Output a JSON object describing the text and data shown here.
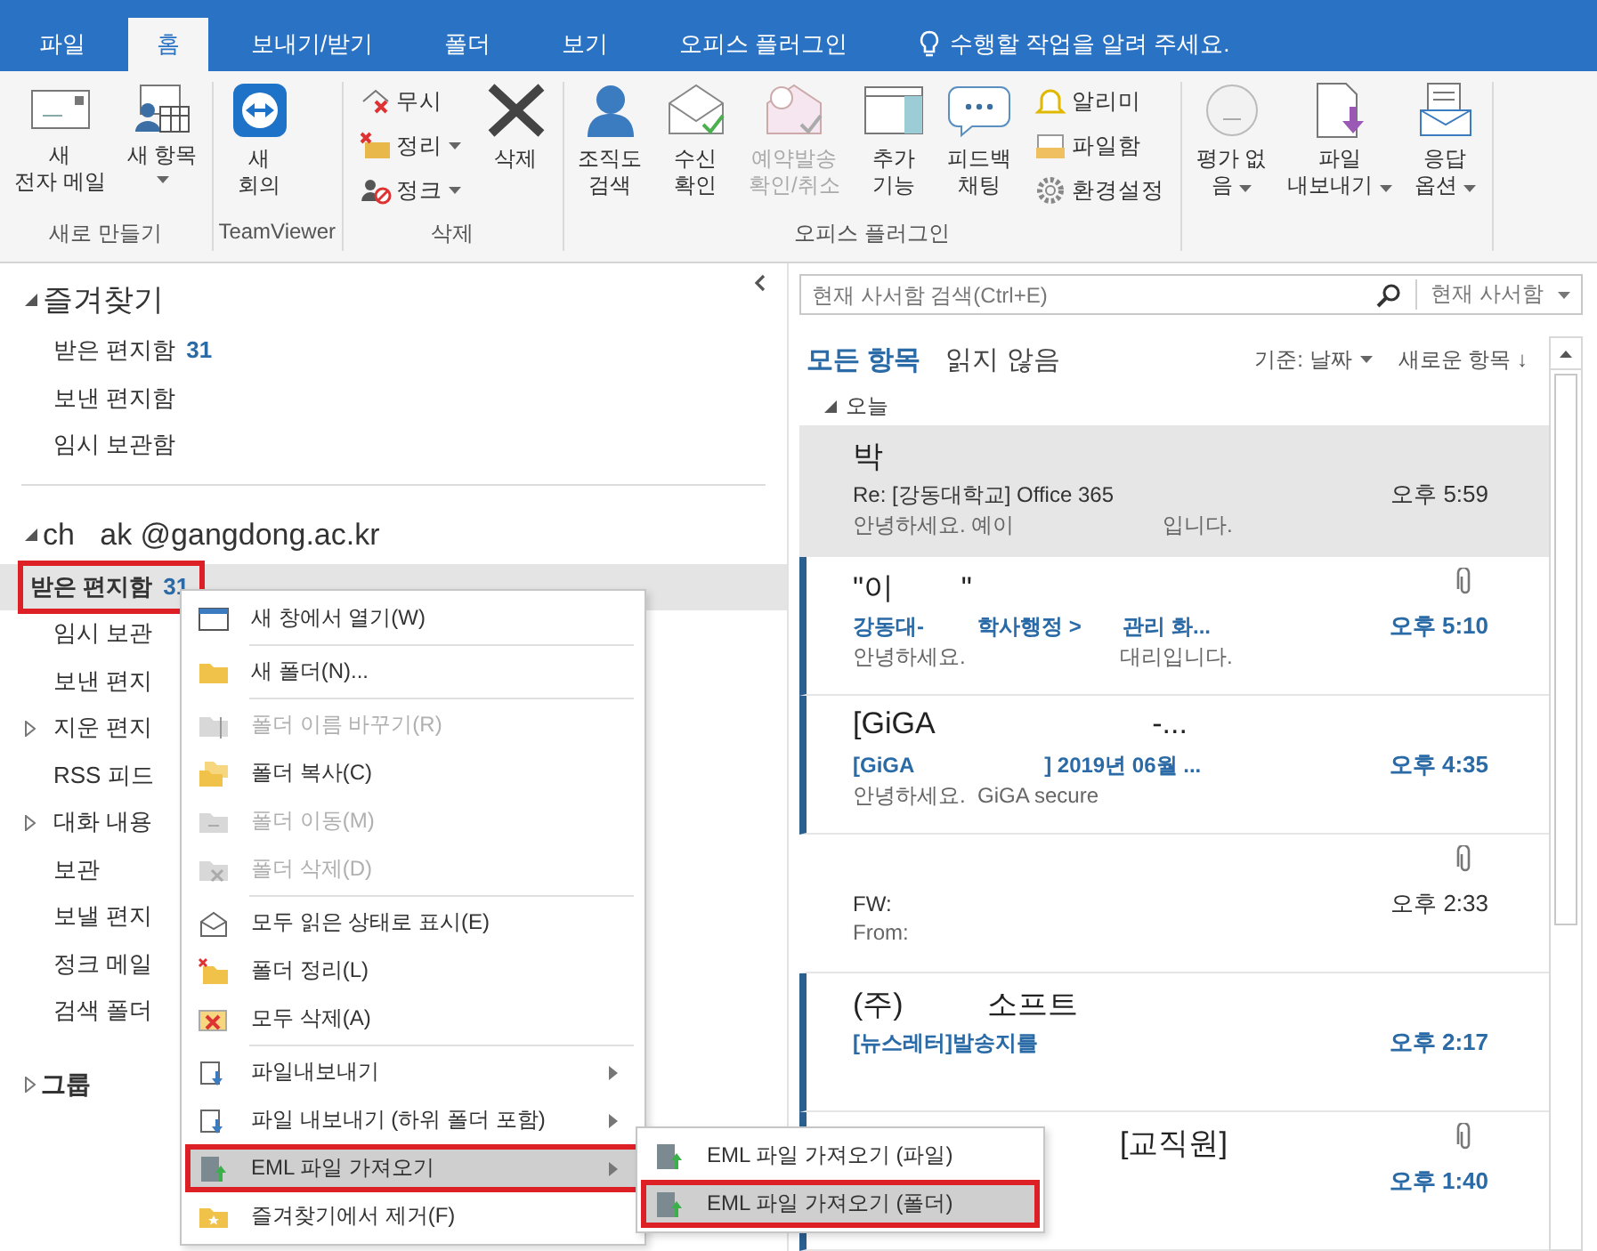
{
  "tabs": [
    {
      "label": "파일",
      "selected": false
    },
    {
      "label": "홈",
      "selected": true
    },
    {
      "label": "보내기/받기",
      "selected": false
    },
    {
      "label": "폴더",
      "selected": false
    },
    {
      "label": "보기",
      "selected": false
    },
    {
      "label": "오피스 플러그인",
      "selected": false
    }
  ],
  "tell_me": "수행할 작업을 알려 주세요.",
  "ribbon": {
    "groups": [
      {
        "label": "새로 만들기",
        "buttons": [
          {
            "kind": "large",
            "label": "새\n전자 메일",
            "dropdown": false,
            "disabled": false
          },
          {
            "kind": "large",
            "label": "새 항목",
            "dropdown": true,
            "disabled": false
          }
        ]
      },
      {
        "label": "TeamViewer",
        "buttons": [
          {
            "kind": "large",
            "label": "새\n회의",
            "dropdown": false,
            "disabled": false
          }
        ]
      },
      {
        "label": "삭제",
        "buttons": [
          {
            "kind": "stack",
            "items": [
              {
                "label": "무시",
                "dropdown": false
              },
              {
                "label": "정리",
                "dropdown": true
              },
              {
                "label": "정크",
                "dropdown": true
              }
            ]
          },
          {
            "kind": "large",
            "label": "삭제",
            "dropdown": false,
            "disabled": false
          }
        ]
      },
      {
        "label": "오피스 플러그인",
        "buttons": [
          {
            "kind": "large",
            "label": "조직도\n검색",
            "dropdown": false,
            "disabled": false
          },
          {
            "kind": "large",
            "label": "수신\n확인",
            "dropdown": false,
            "disabled": false
          },
          {
            "kind": "large",
            "label": "예약발송\n확인/취소",
            "dropdown": false,
            "disabled": true
          },
          {
            "kind": "large",
            "label": "추가\n기능",
            "dropdown": false,
            "disabled": false
          },
          {
            "kind": "large",
            "label": "피드백\n채팅",
            "dropdown": false,
            "disabled": false
          },
          {
            "kind": "stack",
            "items": [
              {
                "label": "알리미",
                "dropdown": false
              },
              {
                "label": "파일함",
                "dropdown": false
              },
              {
                "label": "환경설정",
                "dropdown": false
              }
            ]
          }
        ]
      },
      {
        "buttons": [
          {
            "kind": "large",
            "label": "평가 없\n음",
            "dropdown": true,
            "disabled": false
          },
          {
            "kind": "large",
            "label": "파일\n내보내기",
            "dropdown": true,
            "disabled": false
          },
          {
            "kind": "large",
            "label": "응답\n옵션",
            "dropdown": true,
            "disabled": false
          }
        ]
      }
    ]
  },
  "folder_pane": {
    "sections": [
      {
        "title": "즐겨찾기",
        "expanded": true,
        "folders": [
          {
            "name": "받은 편지함",
            "count": "31",
            "collapsed": false,
            "selected": false,
            "outlined": false
          },
          {
            "name": "보낸 편지함",
            "collapsed": false,
            "selected": false,
            "outlined": false
          },
          {
            "name": "임시 보관함",
            "collapsed": false,
            "selected": false,
            "outlined": false
          }
        ]
      },
      {
        "title": "ch   ak @gangdong.ac.kr",
        "expanded": true,
        "folders": [
          {
            "name": "받은 편지함",
            "count": "31",
            "collapsed": false,
            "selected": true,
            "outlined": true
          },
          {
            "name": "임시 보관",
            "collapsed": false,
            "selected": false,
            "outlined": false
          },
          {
            "name": "보낸 편지",
            "collapsed": false,
            "selected": false,
            "outlined": false
          },
          {
            "name": "지운 편지",
            "collapsed": true,
            "selected": false,
            "outlined": false
          },
          {
            "name": "RSS 피드",
            "collapsed": false,
            "selected": false,
            "outlined": false
          },
          {
            "name": "대화 내용",
            "collapsed": true,
            "selected": false,
            "outlined": false
          },
          {
            "name": "보관",
            "collapsed": false,
            "selected": false,
            "outlined": false
          },
          {
            "name": "보낼 편지",
            "collapsed": false,
            "selected": false,
            "outlined": false
          },
          {
            "name": "정크 메일",
            "collapsed": false,
            "selected": false,
            "outlined": false
          },
          {
            "name": "검색 폴더",
            "collapsed": false,
            "selected": false,
            "outlined": false
          }
        ]
      },
      {
        "title": "그룹",
        "expanded": false
      }
    ]
  },
  "message_list": {
    "search": {
      "placeholder": "현재 사서함 검색(Ctrl+E)",
      "scope": "현재 사서함"
    },
    "filters": [
      {
        "label": "모든 항목",
        "selected": true
      },
      {
        "label": "읽지 않음",
        "selected": false
      }
    ],
    "sort": "기준: 날짜",
    "order": "새로운 항목 ↓",
    "group": "오늘",
    "messages": [
      {
        "sender": "박",
        "subject": "Re: [강동대학교] Office 365",
        "time": "오후 5:59",
        "preview": "안녕하세요. 예이                         입니다.",
        "unread": false,
        "selected": true,
        "attachment": false
      },
      {
        "sender": "\"이        \"",
        "subject": "강동대-         학사행정 >       관리 화...",
        "time": "오후 5:10",
        "preview": "안녕하세요.                          대리입니다.",
        "unread": true,
        "selected": false,
        "attachment": true
      },
      {
        "sender": "[GiGA                          -...",
        "subject": "[GiGA                      ] 2019년 06월 ...",
        "time": "오후 4:35",
        "preview": "안녕하세요.  GiGA secure",
        "unread": true,
        "selected": false,
        "attachment": false
      },
      {
        "subject": "FW:",
        "time": "오후 2:33",
        "preview": "From:",
        "unread": false,
        "selected": false,
        "attachment": true
      },
      {
        "sender": "(주)          소프트",
        "subject": "[뉴스레터]발송지를",
        "time": "오후 2:17",
        "unread": true,
        "selected": false,
        "attachment": false
      },
      {
        "sender": "[교직원]",
        "sender_after_redaction": true,
        "time": "오후 1:40",
        "unread": true,
        "selected": false,
        "attachment": true
      }
    ]
  },
  "context_menu": {
    "items": [
      {
        "kind": "command",
        "label": "새 창에서 열기(W)",
        "disabled": false,
        "selected": false,
        "outlined": false
      },
      {
        "kind": "separator"
      },
      {
        "kind": "command",
        "label": "새 폴더(N)...",
        "disabled": false,
        "selected": false,
        "outlined": false
      },
      {
        "kind": "separator"
      },
      {
        "kind": "command",
        "label": "폴더 이름 바꾸기(R)",
        "disabled": true,
        "selected": false,
        "outlined": false
      },
      {
        "kind": "command",
        "label": "폴더 복사(C)",
        "disabled": false,
        "selected": false,
        "outlined": false
      },
      {
        "kind": "command",
        "label": "폴더 이동(M)",
        "disabled": true,
        "selected": false,
        "outlined": false
      },
      {
        "kind": "command",
        "label": "폴더 삭제(D)",
        "disabled": true,
        "selected": false,
        "outlined": false
      },
      {
        "kind": "separator"
      },
      {
        "kind": "command",
        "label": "모두 읽은 상태로 표시(E)",
        "disabled": false,
        "selected": false,
        "outlined": false
      },
      {
        "kind": "command",
        "label": "폴더 정리(L)",
        "disabled": false,
        "selected": false,
        "outlined": false
      },
      {
        "kind": "command",
        "label": "모두 삭제(A)",
        "disabled": false,
        "selected": false,
        "outlined": false
      },
      {
        "kind": "separator"
      },
      {
        "kind": "submenu",
        "label": "파일내보내기",
        "disabled": false,
        "selected": false,
        "outlined": false
      },
      {
        "kind": "submenu",
        "label": "파일 내보내기 (하위 폴더 포함)",
        "disabled": false,
        "selected": false,
        "outlined": false
      },
      {
        "kind": "submenu",
        "label": "EML 파일 가져오기",
        "disabled": false,
        "selected": true,
        "outlined": true
      },
      {
        "kind": "command",
        "label": "즐겨찾기에서 제거(F)",
        "disabled": false,
        "selected": false,
        "outlined": false
      }
    ]
  },
  "submenu": {
    "items": [
      {
        "label": "EML 파일 가져오기 (파일)",
        "selected": false,
        "outlined": false
      },
      {
        "label": "EML 파일 가져오기 (폴더)",
        "selected": true,
        "outlined": true
      }
    ]
  }
}
